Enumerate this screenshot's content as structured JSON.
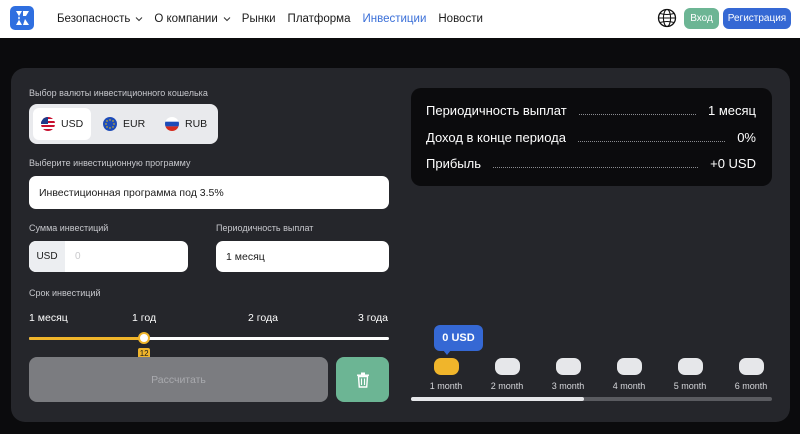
{
  "nav": {
    "items": [
      {
        "label": "Безопасность",
        "has_dropdown": true,
        "active": false
      },
      {
        "label": "О компании",
        "has_dropdown": true,
        "active": false
      },
      {
        "label": "Рынки",
        "has_dropdown": false,
        "active": false
      },
      {
        "label": "Платформа",
        "has_dropdown": false,
        "active": false
      },
      {
        "label": "Инвестиции",
        "has_dropdown": false,
        "active": true
      },
      {
        "label": "Новости",
        "has_dropdown": false,
        "active": false
      }
    ],
    "login_label": "Вход",
    "register_label": "Регистрация",
    "icons": {
      "logo": "brand-logo",
      "language": "globe-icon"
    }
  },
  "form": {
    "currency_label": "Выбор валюты инвестиционного кошелька",
    "currencies": [
      {
        "code": "USD",
        "icon": "us-flag-icon",
        "selected": true
      },
      {
        "code": "EUR",
        "icon": "eu-flag-icon",
        "selected": false
      },
      {
        "code": "RUB",
        "icon": "ru-flag-icon",
        "selected": false
      }
    ],
    "program_label": "Выберите инвестиционную программу",
    "program_value": "Инвестиционная программа под 3.5%",
    "amount_label": "Сумма инвестиций",
    "amount_prefix": "USD",
    "amount_placeholder": "0",
    "frequency_label": "Периодичность выплат",
    "frequency_value": "1 месяц",
    "term_label": "Срок инвестиций",
    "term_ticks": [
      "1 месяц",
      "1 год",
      "2 года",
      "3 года"
    ],
    "term_value": "12",
    "term_min": 1,
    "term_max": 36,
    "term_current": 12,
    "calculate_label": "Рассчитать",
    "delete_icon": "trash-icon"
  },
  "result": {
    "rows": [
      {
        "label": "Периодичность выплат",
        "value": "1 месяц"
      },
      {
        "label": "Доход в конце периода",
        "value": "0%"
      },
      {
        "label": "Прибыль",
        "value": "+0 USD"
      }
    ]
  },
  "chart": {
    "tooltip": "0 USD",
    "months": [
      "1 month",
      "2 month",
      "3 month",
      "4 month",
      "5 month",
      "6 month"
    ],
    "active_index": 0,
    "scroll_fraction": 0.48
  },
  "colors": {
    "accent_blue": "#3568d4",
    "accent_green": "#6cb594",
    "accent_yellow": "#f0b52b",
    "card_bg": "#25262b",
    "page_bg": "#0b0b0d"
  }
}
